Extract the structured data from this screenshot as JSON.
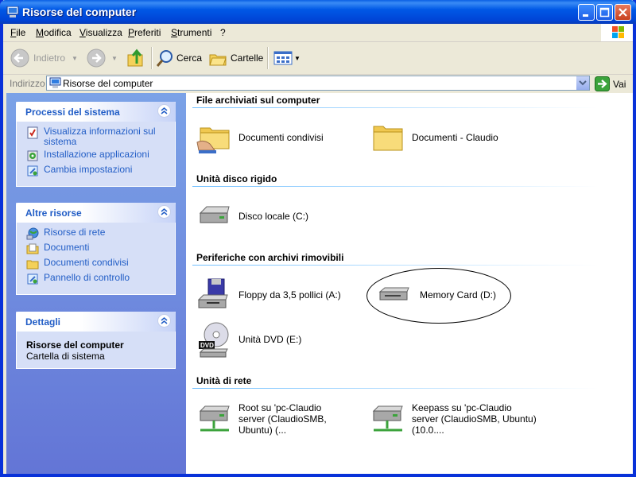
{
  "window": {
    "title": "Risorse del computer"
  },
  "menu": [
    "File",
    "Modifica",
    "Visualizza",
    "Preferiti",
    "Strumenti",
    "?"
  ],
  "toolbar": {
    "back_label": "Indietro",
    "search_label": "Cerca",
    "folders_label": "Cartelle"
  },
  "address": {
    "label": "Indirizzo",
    "value": "Risorse del computer",
    "go_label": "Vai"
  },
  "sidebar": {
    "system_tasks": {
      "title": "Processi del sistema",
      "items": [
        "Visualizza informazioni sul sistema",
        "Installazione applicazioni",
        "Cambia impostazioni"
      ]
    },
    "other_places": {
      "title": "Altre risorse",
      "items": [
        "Risorse di rete",
        "Documenti",
        "Documenti condivisi",
        "Pannello di controllo"
      ]
    },
    "details": {
      "title": "Dettagli",
      "name": "Risorse del computer",
      "type": "Cartella di sistema"
    }
  },
  "groups": [
    {
      "title": "File archiviati sul computer",
      "items": [
        "Documenti condivisi",
        "Documenti - Claudio"
      ]
    },
    {
      "title": "Unità disco rigido",
      "items": [
        "Disco locale (C:)"
      ]
    },
    {
      "title": "Periferiche con archivi rimovibili",
      "items": [
        "Floppy da 3,5 pollici (A:)",
        "Memory Card (D:)",
        "Unità DVD (E:)"
      ]
    },
    {
      "title": "Unità di rete",
      "items": [
        "Root su 'pc-Claudio server (ClaudioSMB, Ubuntu) (...",
        "Keepass su 'pc-Claudio server (ClaudioSMB, Ubuntu) (10.0...."
      ]
    }
  ],
  "colors": {
    "titlebar": "#0058E6",
    "link": "#215DC6",
    "sidebar": "#6D8FE0"
  }
}
